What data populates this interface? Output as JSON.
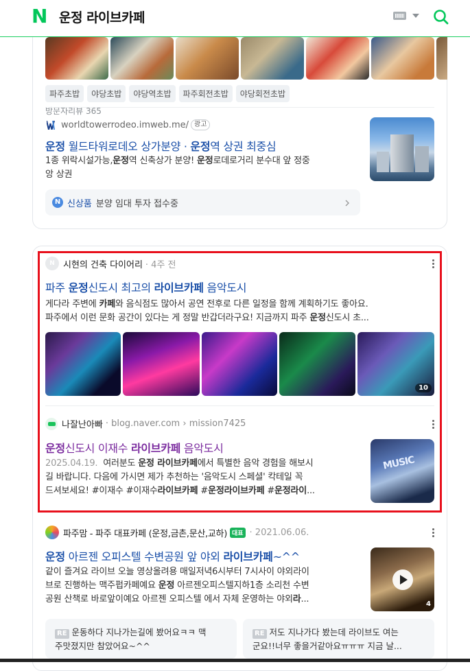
{
  "header": {
    "query": "운정 라이브카페",
    "logo": "N"
  },
  "card1": {
    "tags": [
      "파주초밥",
      "야당초밥",
      "야당역초밥",
      "파주회전초밥",
      "야당회전초밥"
    ],
    "review_label": "방문자리뷰 365",
    "ad_domain": "worldtowerrodeo.imweb.me/",
    "ad_badge": "광고",
    "ad_title_a": "운정",
    "ad_title_b": " 월드타워로데오 상가분양 · ",
    "ad_title_c": "운정",
    "ad_title_d": "역 상권 최중심",
    "ad_desc_a": "1종 위락시설가능,",
    "ad_desc_b": "운정",
    "ad_desc_c": "역 신축상가 분양! ",
    "ad_desc_d": "운정",
    "ad_desc_e": "로데로거리 분수대 앞 정중",
    "ad_desc_f": "앙 상권",
    "new_label": "신상품",
    "new_text": "분양 임대 투자 접수중"
  },
  "post1": {
    "author": "시현의 건축 다이어리",
    "time": "· 4주 전",
    "title_a": "파주 ",
    "title_b": "운정",
    "title_c": "신도시 최고의 ",
    "title_d": "라이브카페",
    "title_e": " 음악도시",
    "desc1_a": "게다라 주변에 ",
    "desc1_b": "카페",
    "desc1_c": "와 음식점도 많아서 공연 전후로 다른 일정을 함께 계획하기도 좋아요.",
    "desc2_a": "파주에서 이런 문화 공간이 있다는 게 정말 반갑더라구요! 지금까지 파주 ",
    "desc2_b": "운정",
    "desc2_c": "신도시 초...",
    "image_count": "10"
  },
  "post2": {
    "author": "나잘난아빠",
    "source": "· blog.naver.com › mission7425",
    "title_a": "운정",
    "title_b": "신도시 이재수 ",
    "title_c": "라이브카페",
    "title_d": " 음악도시",
    "date": "2025.04.19.",
    "d1_a": "여러분도 ",
    "d1_b": "운정 라이브카페",
    "d1_c": "에서 특별한 음악 경험을 해보시",
    "d2": "길 바랍니다. 다음에 가시면 제가 추천하는 '음악도시 스페셜' 칵테일 꼭",
    "d3_a": "드셔보세요! #이재수 #이재수",
    "d3_b": "라이브카페",
    "d3_c": " #",
    "d3_d": "운정라이브카페",
    "d3_e": " #",
    "d3_f": "운정라이",
    "d3_g": "..."
  },
  "post3": {
    "author": "파주맘 - 파주 대표카페 (운정,금촌,문산,교하)",
    "badge": "대표",
    "time": "· 2021.06.06.",
    "title_a": "운정",
    "title_b": " 아르젠 오피스텔 수변공원 앞 야외 ",
    "title_c": "라이브카페",
    "title_d": "~^^",
    "d1": "같이 즐겨요 라이브 오늘 영상올려용 매일저녁6시부터 7시사이 야외라이",
    "d2_a": "브로 진행하는 맥주펍카페예요 ",
    "d2_b": "운정",
    "d2_c": " 아르젠오피스텔지하1층 소리천 수변",
    "d3_a": "공원 산책로 바로앞이예요 아르젠 오피스텔 에서 자체 운영하는 야외",
    "d3_b": "라",
    "d3_c": "...",
    "video_count": "4",
    "comment1_a": "운동하다 지나가는길에 봤어요ㅋㅋ 맥",
    "comment1_b": "주맛졌지만 참았어요~^^",
    "comment2_a": "저도 지나가다 봤는데 라이브도 여는",
    "comment2_b": "군요!!너무 좋을거같아요ㅠㅠㅠ 지금 날...",
    "re": "RE"
  },
  "colors": {
    "naver_green": "#03c75a",
    "link_blue": "#1a4fa8",
    "visited_purple": "#7a2a9e",
    "highlight_red": "#e8101c"
  },
  "icons": [
    "naver-logo-icon",
    "keyboard-icon",
    "chevron-down-icon",
    "search-icon",
    "w-logo-icon",
    "n-badge-icon",
    "chevron-right-icon",
    "more-icon",
    "blog-icon",
    "cafe-icon",
    "play-icon"
  ]
}
